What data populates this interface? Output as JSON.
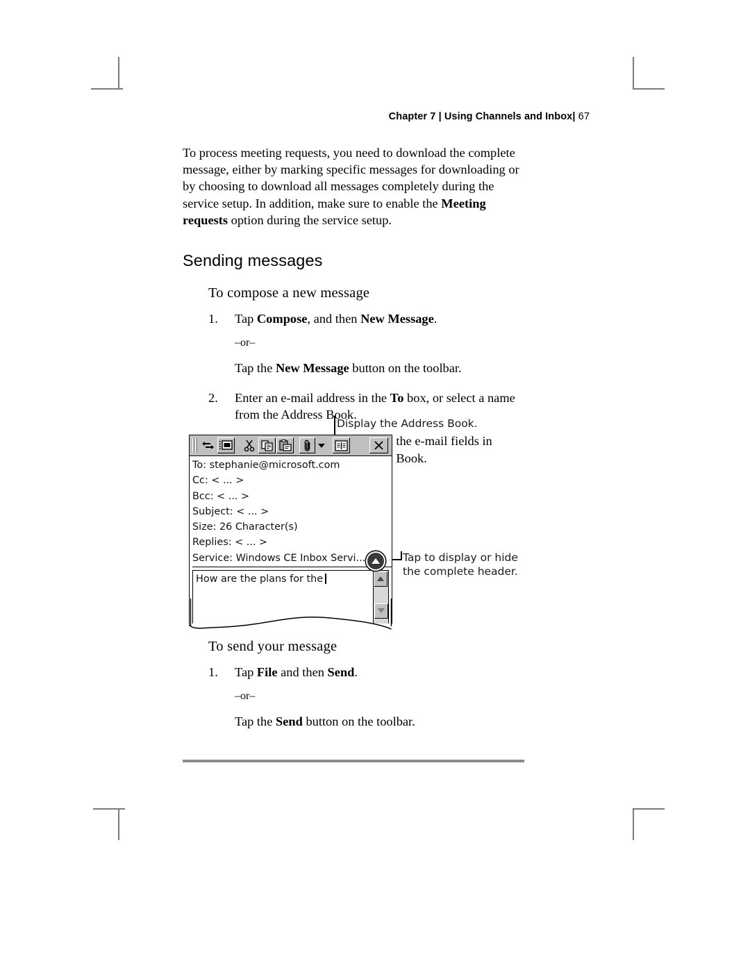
{
  "running_head": {
    "chapter": "Chapter 7 | Using Channels and Inbox",
    "separator": "|",
    "page_number": "67"
  },
  "intro_paragraph": {
    "part1": "To process meeting requests, you need to download the complete message, either by marking specific messages for downloading or by choosing to download all messages completely during the service setup. In addition, make sure to enable the ",
    "bold": "Meeting requests",
    "part2": " option during the service setup."
  },
  "section": {
    "title": "Sending messages"
  },
  "procedure_compose": {
    "title": "To compose a new message",
    "step1": {
      "number": "1.",
      "text_pre": "Tap ",
      "bold1": "Compose",
      "text_mid": ", and then ",
      "bold2": "New Message",
      "text_post": "."
    },
    "or": "–or–",
    "alt": {
      "pre": "Tap the ",
      "bold": "New Message",
      "post": " button on the toolbar."
    },
    "step2": {
      "number": "2.",
      "text_pre": "Enter an e-mail address in the ",
      "bold": "To",
      "text_post": " box, or select a name from the Address Book."
    },
    "note": "All e-mail addresses entered in the e-mail fields in Contacts appear in the Address Book."
  },
  "figure": {
    "callout_address_book": "Display the Address Book.",
    "callout_header_toggle_line1": "Tap to display or hide",
    "callout_header_toggle_line2": "the complete header.",
    "toolbar": {
      "buttons": [
        {
          "name": "send-icon",
          "label": "Send"
        },
        {
          "name": "new-message-icon",
          "label": "New Message"
        },
        {
          "name": "cut-icon",
          "label": "Cut"
        },
        {
          "name": "copy-icon",
          "label": "Copy"
        },
        {
          "name": "paste-icon",
          "label": "Paste"
        },
        {
          "name": "attach-icon",
          "label": "Insert file"
        },
        {
          "name": "attach-dropdown-icon",
          "label": "Attachment options"
        },
        {
          "name": "address-book-icon",
          "label": "Address Book"
        },
        {
          "name": "close-icon",
          "label": "Close"
        }
      ]
    },
    "header_fields": [
      {
        "label": "To:",
        "value": "stephanie@microsoft.com"
      },
      {
        "label": "Cc:",
        "value": "< ... >"
      },
      {
        "label": "Bcc:",
        "value": "< ... >"
      },
      {
        "label": "Subject:",
        "value": "< ... >"
      },
      {
        "label": "Size:",
        "value": "26 Character(s)"
      },
      {
        "label": "Replies:",
        "value": "< ... >"
      },
      {
        "label": "Service:",
        "value": "Windows CE Inbox Servi..."
      }
    ],
    "body_text": "How are the plans for the"
  },
  "procedure_send": {
    "title": "To send your message",
    "step1": {
      "number": "1.",
      "text_pre": "Tap ",
      "bold1": "File",
      "text_mid": " and then ",
      "bold2": "Send",
      "text_post": "."
    },
    "or": "–or–",
    "alt": {
      "pre": "Tap the ",
      "bold": "Send",
      "post": " button on the toolbar."
    }
  }
}
